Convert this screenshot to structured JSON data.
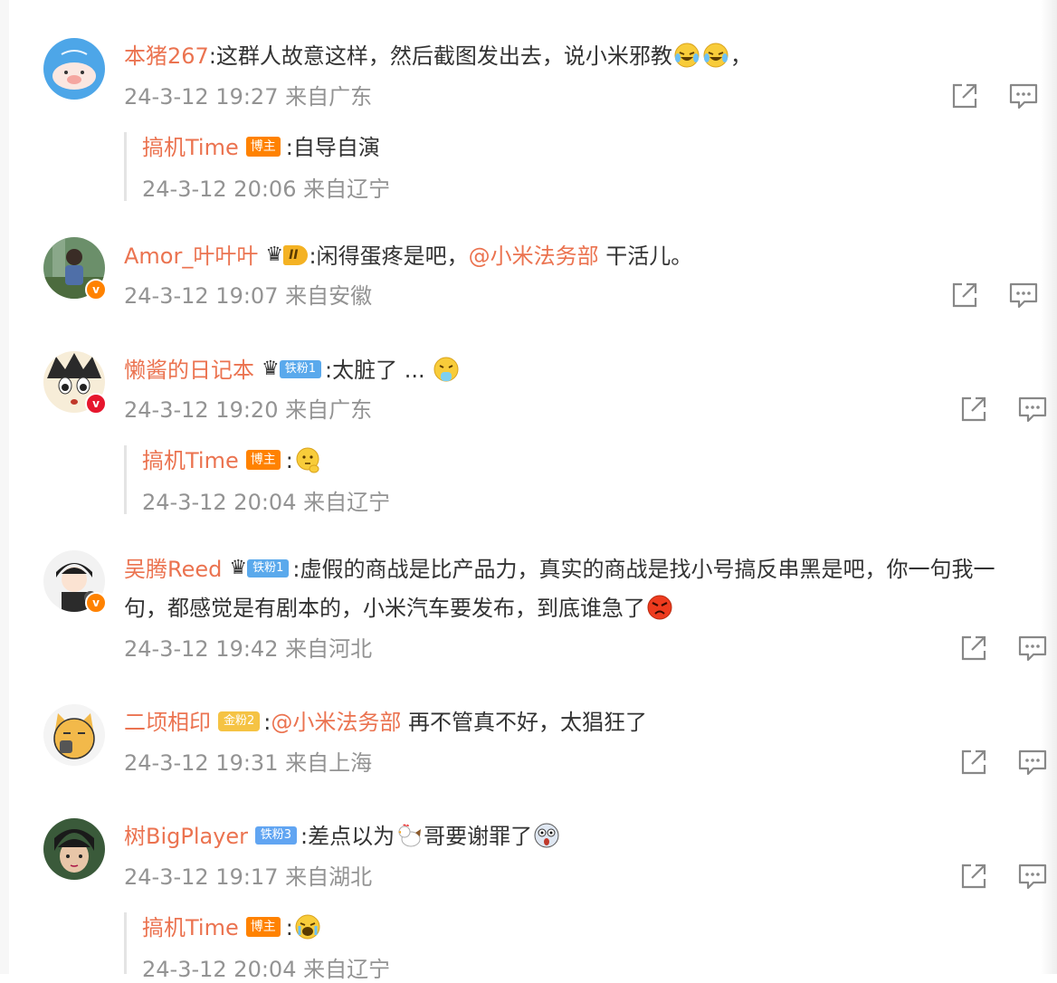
{
  "comments": [
    {
      "username": "本猪267",
      "text": ":这群人故意这样，然后截图发出去，说小米邪教",
      "text_end": "，",
      "time": "24-3-12 19:27",
      "location": "来自广东",
      "emojis": [
        "laugh-cry-emoji",
        "laugh-cry-emoji"
      ],
      "reply": {
        "username": "搞机Time",
        "badge": "博主",
        "text": ":自导自演",
        "time": "24-3-12 20:06",
        "location": "来自辽宁"
      }
    },
    {
      "username": "Amor_叶叶叶",
      "vip_level": "II",
      "text": ":闲得蛋疼是吧，",
      "mention": "@小米法务部",
      "text_after": " 干活儿。",
      "time": "24-3-12 19:07",
      "location": "来自安徽"
    },
    {
      "username": "懒酱的日记本",
      "fan_badge": "铁粉1",
      "text": ":太脏了 ...",
      "emojis": [
        "vomit-emoji"
      ],
      "time": "24-3-12 19:20",
      "location": "来自广东",
      "reply": {
        "username": "搞机Time",
        "badge": "博主",
        "text": ":",
        "emojis": [
          "thinking-emoji"
        ],
        "time": "24-3-12 20:04",
        "location": "来自辽宁"
      }
    },
    {
      "username": "吴腾Reed",
      "fan_badge": "铁粉1",
      "text_line1": ":虚假的商战是比产品力，真实的商战是找小号搞反串黑是吧，你一句我一",
      "text_line2": "句，都感觉是有剧本的，小米汽车要发布，到底谁急了",
      "emojis": [
        "angry-emoji"
      ],
      "time": "24-3-12 19:42",
      "location": "来自河北"
    },
    {
      "username": "二顷相印",
      "fan_badge": "金粉2",
      "text": ":",
      "mention": "@小米法务部",
      "text_after": " 再不管真不好，太猖狂了",
      "time": "24-3-12 19:31",
      "location": "来自上海"
    },
    {
      "username": "树BigPlayer",
      "fan_badge": "铁粉3",
      "text": ":差点以为",
      "text_after": "哥要谢罪了",
      "emojis": [
        "chicken-emoji",
        "scared-emoji"
      ],
      "time": "24-3-12 19:17",
      "location": "来自湖北",
      "reply": {
        "username": "搞机Time",
        "badge": "博主",
        "text": ":",
        "emojis": [
          "crying-emoji"
        ],
        "time": "24-3-12 20:04",
        "location": "来自辽宁"
      }
    }
  ],
  "colors": {
    "username": "#eb7350",
    "meta": "#939393",
    "text": "#333333",
    "badge_boss": "#ff8200",
    "badge_fan": "#5aa9ec",
    "badge_gold": "#f5c344"
  },
  "icons": {
    "share": "share-icon",
    "comment": "comment-icon"
  }
}
